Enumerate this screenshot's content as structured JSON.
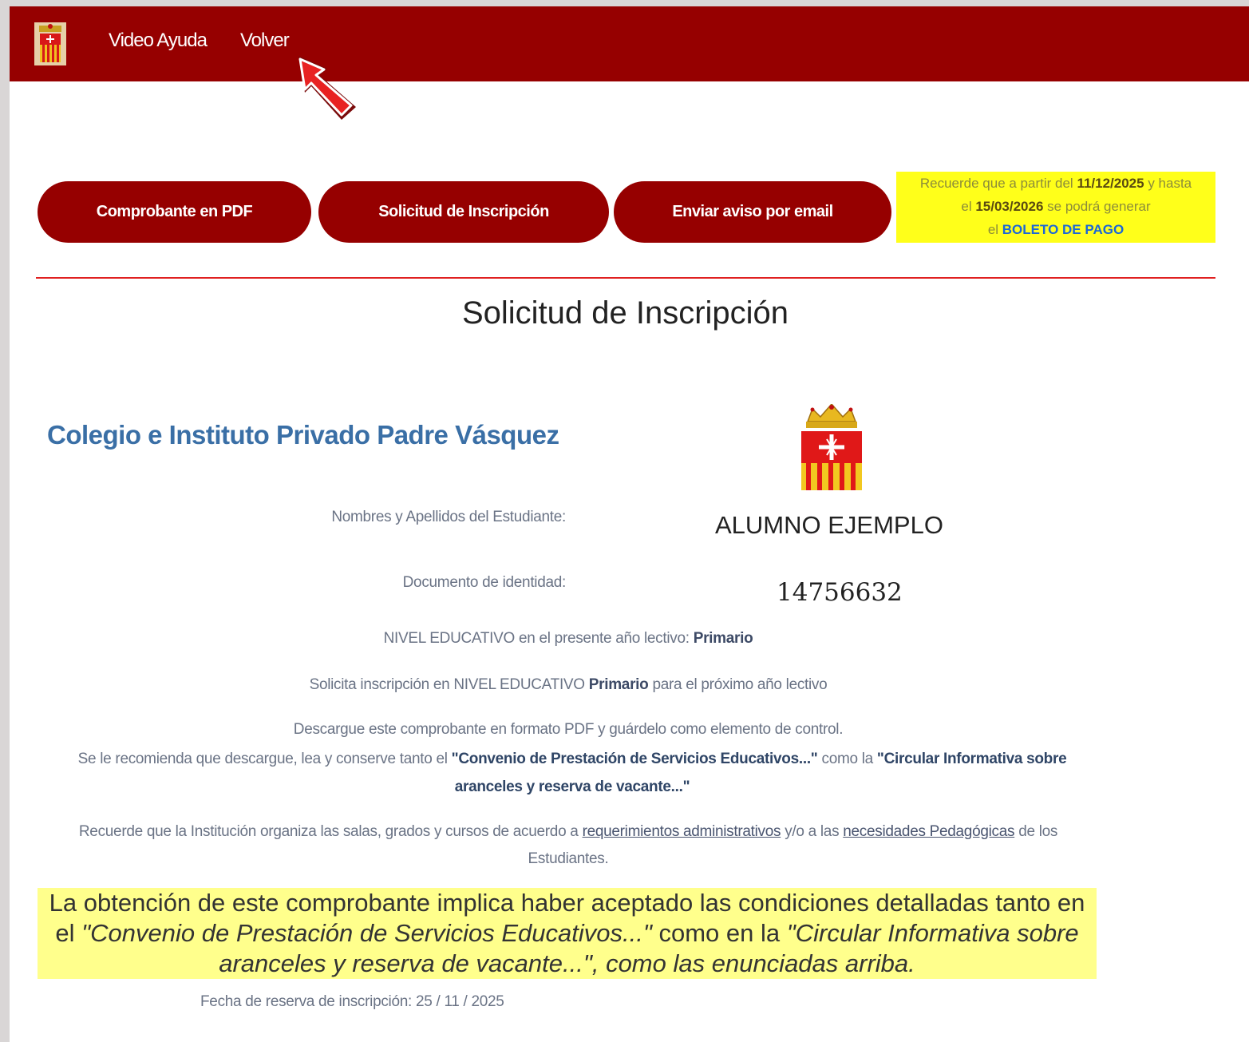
{
  "nav": {
    "video_help": "Video Ayuda",
    "back": "Volver"
  },
  "buttons": {
    "pdf": "Comprobante en PDF",
    "request": "Solicitud de Inscripción",
    "email": "Enviar aviso por email"
  },
  "notice": {
    "prefix": "Recuerde que a partir del",
    "date_from": "11/12/2025",
    "mid1": "y hasta",
    "el": "el",
    "date_to": "15/03/2026",
    "mid2": "se podrá generar",
    "el2": "el",
    "link": "BOLETO DE PAGO"
  },
  "page": {
    "title": "Solicitud de Inscripción",
    "school": "Colegio e Instituto Privado Padre Vásquez"
  },
  "student": {
    "name_label": "Nombres y Apellidos del Estudiante:",
    "name": "ALUMNO EJEMPLO",
    "doc_label": "Documento de identidad:",
    "doc": "14756632"
  },
  "level": {
    "current_prefix": "NIVEL EDUCATIVO en el presente año lectivo:",
    "current": "Primario",
    "request_prefix": "Solicita inscripción en NIVEL EDUCATIVO",
    "requested": "Primario",
    "request_suffix": "para el próximo año lectivo"
  },
  "info": {
    "download": "Descargue este comprobante en formato PDF y guárdelo como elemento de control.",
    "recommend_prefix": "Se le recomienda que descargue, lea y conserve tanto el",
    "convenio": "\"Convenio de Prestación de Servicios Educativos...\"",
    "recommend_mid": "como la",
    "circular": "\"Circular Informativa sobre aranceles y reserva de vacante...\"",
    "institution_prefix": "Recuerde que la Institución organiza las salas, grados y cursos de acuerdo a",
    "requirements": "requerimientos administrativos",
    "institution_mid": "y/o a las",
    "needs": "necesidades Pedagógicas",
    "institution_suffix": "de los Estudiantes."
  },
  "highlight": {
    "prefix": "La obtención de este comprobante implica haber aceptado las condiciones detalladas tanto en el",
    "convenio": "\"Convenio de Prestación de Servicios Educativos...\"",
    "mid": "como en la",
    "circular": "\"Circular Informativa sobre aranceles y reserva de vacante...\", como las enunciadas arriba."
  },
  "reservation": {
    "label": "Fecha de reserva de inscripción:",
    "date": "25 / 11 / 2025"
  },
  "colors": {
    "brand": "#960000",
    "notice_bg": "#ffff1a",
    "highlight_bg": "#ffff8c",
    "school_blue": "#3a6fa6"
  },
  "icons": [
    "crest-logo-icon",
    "red-arrow-pointer-icon",
    "crest-icon"
  ]
}
